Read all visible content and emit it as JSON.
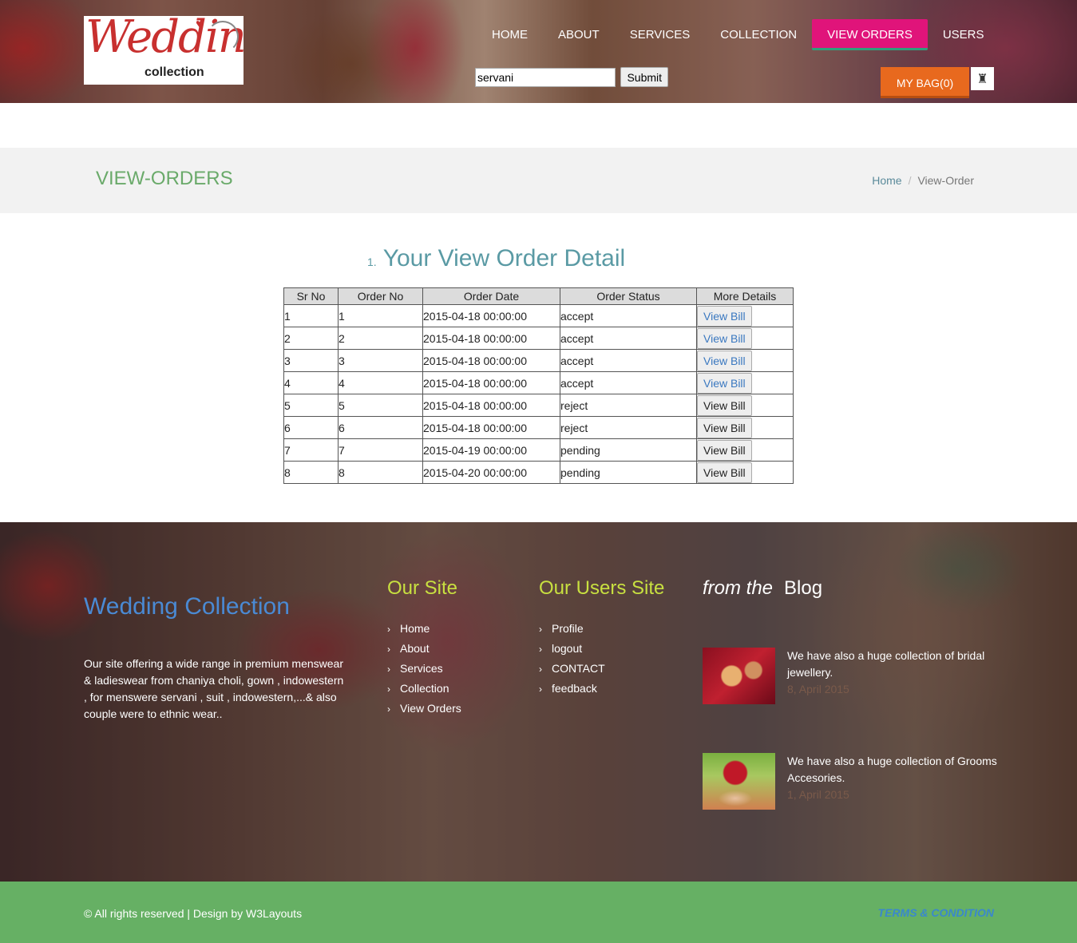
{
  "header": {
    "logo": {
      "main": "Wedding",
      "sub": "collection"
    },
    "nav": [
      "HOME",
      "ABOUT",
      "SERVICES",
      "COLLECTION",
      "VIEW ORDERS",
      "USERS"
    ],
    "active_nav": "VIEW ORDERS",
    "search": {
      "value": "servani",
      "button": "Submit"
    },
    "bag": "MY BAG(0)"
  },
  "banner": {
    "title": "VIEW-ORDERS",
    "breadcrumb": {
      "home": "Home",
      "current": "View-Order"
    }
  },
  "content": {
    "list_number": "1.",
    "title": "Your View Order Detail",
    "columns": [
      "Sr No",
      "Order No",
      "Order Date",
      "Order Status",
      "More Details"
    ],
    "rows": [
      {
        "sr": "1",
        "order": "1",
        "date": "2015-04-18 00:00:00",
        "status": "accept",
        "action": "View Bill"
      },
      {
        "sr": "2",
        "order": "2",
        "date": "2015-04-18 00:00:00",
        "status": "accept",
        "action": "View Bill"
      },
      {
        "sr": "3",
        "order": "3",
        "date": "2015-04-18 00:00:00",
        "status": "accept",
        "action": "View Bill"
      },
      {
        "sr": "4",
        "order": "4",
        "date": "2015-04-18 00:00:00",
        "status": "accept",
        "action": "View Bill"
      },
      {
        "sr": "5",
        "order": "5",
        "date": "2015-04-18 00:00:00",
        "status": "reject",
        "action": "View Bill"
      },
      {
        "sr": "6",
        "order": "6",
        "date": "2015-04-18 00:00:00",
        "status": "reject",
        "action": "View Bill"
      },
      {
        "sr": "7",
        "order": "7",
        "date": "2015-04-19 00:00:00",
        "status": "pending",
        "action": "View Bill"
      },
      {
        "sr": "8",
        "order": "8",
        "date": "2015-04-20 00:00:00",
        "status": "pending",
        "action": "View Bill"
      }
    ]
  },
  "footer": {
    "about": {
      "title": "Wedding Collection",
      "text": "Our site offering a wide range in premium menswear & ladieswear from chaniya choli, gown , indowestern , for menswere servani , suit , indowestern,...& also couple were to ethnic wear.."
    },
    "our_site": {
      "title": "Our Site",
      "links": [
        "Home",
        "About",
        "Services",
        "Collection",
        "View Orders"
      ]
    },
    "users_site": {
      "title": "Our Users Site",
      "links": [
        "Profile",
        "logout",
        "CONTACT",
        "feedback"
      ]
    },
    "blog": {
      "title_prefix": "from the",
      "title": "Blog",
      "posts": [
        {
          "text": "We have also a huge collection of bridal jewellery.",
          "date": "8, April 2015",
          "image": "bridal-jewellery-image"
        },
        {
          "text": "We have also a huge collection of Grooms Accesories.",
          "date": "1, April 2015",
          "image": "grooms-accessories-image"
        }
      ]
    },
    "copyright": "© All rights reserved | Design by W3Layouts",
    "terms": "TERMS & CONDITION"
  },
  "colors": {
    "nav_active": "#e0147a",
    "bag": "#e8691e",
    "banner_title": "#6aaa6a",
    "detail_title": "#5a9aa4",
    "footer_bar": "#66b064",
    "link_blue": "#3a78c0",
    "footer_heading_yellow": "#c8e040"
  }
}
